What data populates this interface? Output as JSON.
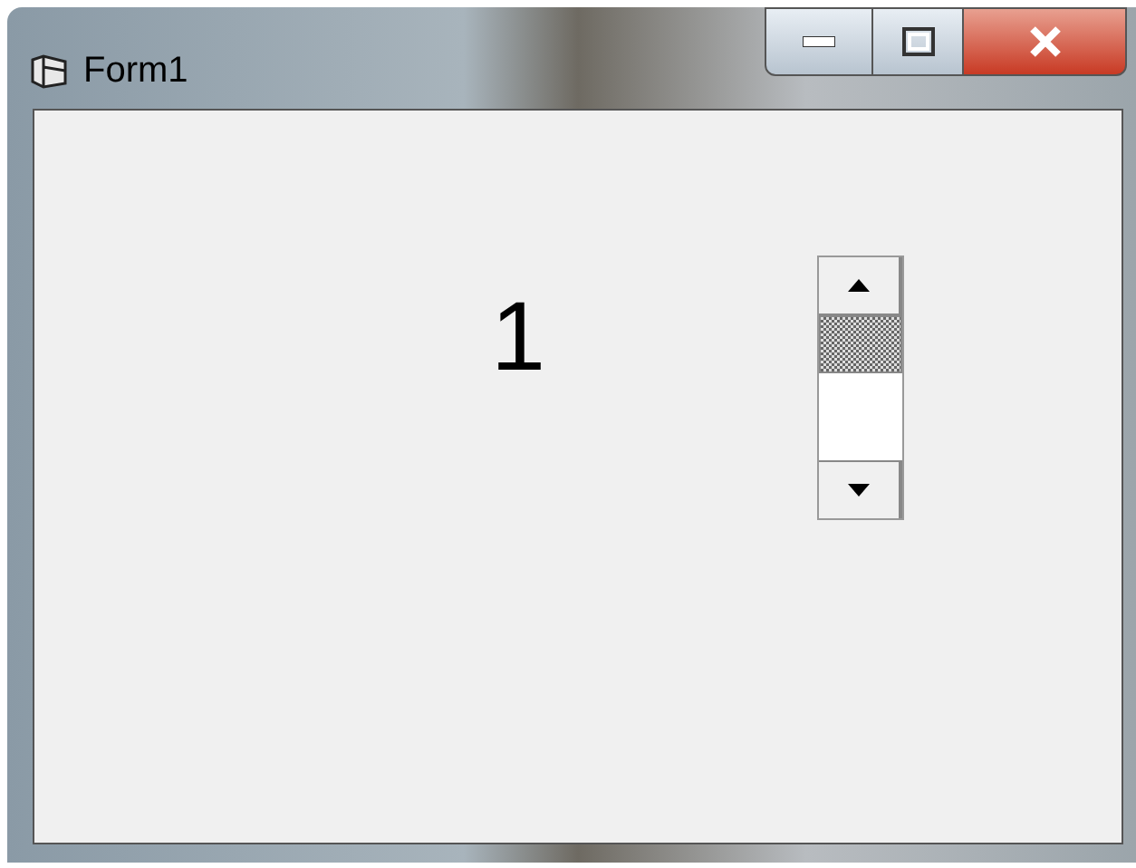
{
  "window": {
    "title": "Form1"
  },
  "label": {
    "text": "1"
  }
}
